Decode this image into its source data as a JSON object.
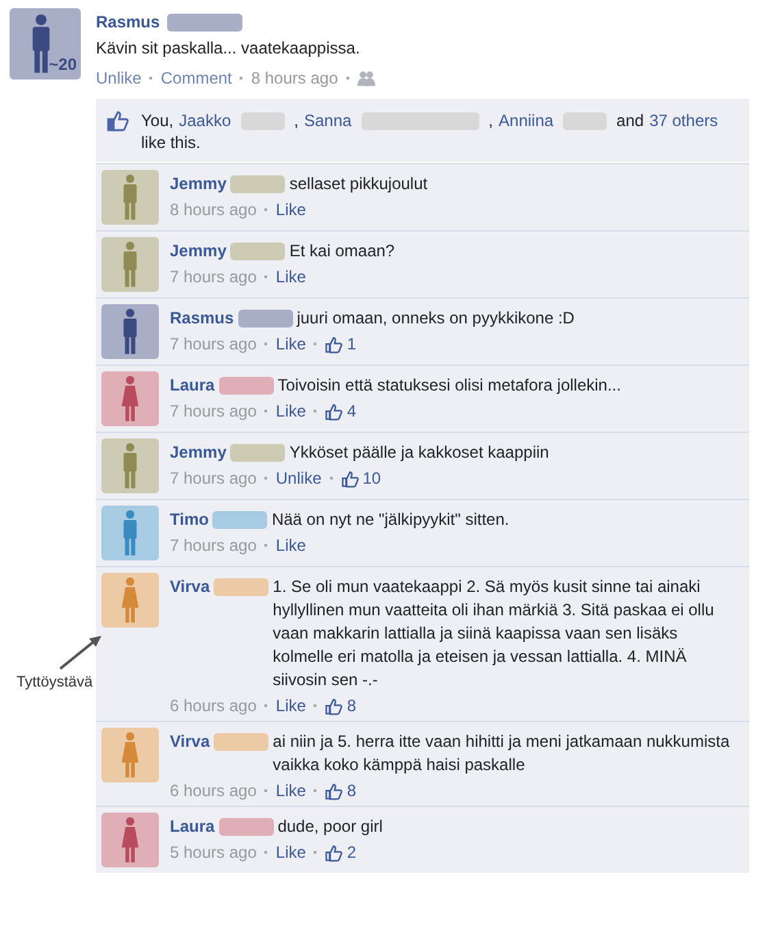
{
  "post": {
    "author": "Rasmus",
    "color": "#3b4a80",
    "kind": "male",
    "avatar_badge": "~20",
    "text": "Kävin sit paskalla... vaatekaappissa.",
    "actions": [
      {
        "kind": "link",
        "text": "Unlike"
      },
      {
        "kind": "link",
        "text": "Comment"
      },
      {
        "kind": "time",
        "text": "8 hours ago"
      },
      {
        "kind": "audience"
      }
    ]
  },
  "likes": {
    "parts": [
      {
        "kind": "text",
        "text": "You,"
      },
      {
        "kind": "link",
        "text": "Jaakko"
      },
      {
        "kind": "redacted"
      },
      {
        "kind": "text",
        "text": ","
      },
      {
        "kind": "link",
        "text": "Sanna"
      },
      {
        "kind": "redacted-long"
      },
      {
        "kind": "text",
        "text": ","
      },
      {
        "kind": "link",
        "text": "Anniina"
      },
      {
        "kind": "redacted"
      },
      {
        "kind": "text",
        "text": "and"
      },
      {
        "kind": "link",
        "text": "37 others"
      },
      {
        "kind": "text",
        "text": "like this."
      }
    ]
  },
  "comments": [
    {
      "author": "Jemmy",
      "kind": "male",
      "color": "#8f8b55",
      "text": "sellaset pikkujoulut",
      "time": "8 hours ago",
      "like_label": "Like"
    },
    {
      "author": "Jemmy",
      "kind": "male",
      "color": "#8f8b55",
      "text": "Et kai omaan?",
      "time": "7 hours ago",
      "like_label": "Like"
    },
    {
      "author": "Rasmus",
      "kind": "male",
      "color": "#3b4a80",
      "text": "juuri omaan, onneks on pyykkikone :D",
      "time": "7 hours ago",
      "like_label": "Like",
      "likes": "1"
    },
    {
      "author": "Laura",
      "kind": "female",
      "color": "#b84b5c",
      "text": "Toivoisin että statuksesi olisi metafora jollekin...",
      "time": "7 hours ago",
      "like_label": "Like",
      "likes": "4"
    },
    {
      "author": "Jemmy",
      "kind": "male",
      "color": "#8f8b55",
      "text": "Ykköset päälle ja kakkoset kaappiin",
      "time": "7 hours ago",
      "like_label": "Unlike",
      "likes": "10"
    },
    {
      "author": "Timo",
      "kind": "male",
      "color": "#3a8bc0",
      "text": "Nää on nyt ne \"jälkipyykit\" sitten.",
      "time": "7 hours ago",
      "like_label": "Like"
    },
    {
      "author": "Virva",
      "kind": "female",
      "color": "#d58a3a",
      "text": "1. Se oli mun vaatekaappi 2. Sä myös kusit sinne tai ainaki hyllyllinen mun vaatteita oli ihan märkiä 3. Sitä paskaa ei ollu vaan makkarin lattialla ja siinä kaapissa vaan sen lisäks kolmelle eri matolla ja eteisen ja vessan lattialla. 4. MINÄ siivosin sen -.-",
      "time": "6 hours ago",
      "like_label": "Like",
      "likes": "8",
      "annotation": "Tyttöystävä"
    },
    {
      "author": "Virva",
      "kind": "female",
      "color": "#d58a3a",
      "text": "ai niin ja 5. herra itte vaan hihitti ja meni jatkamaan nukkumista vaikka koko kämppä haisi paskalle",
      "time": "6 hours ago",
      "like_label": "Like",
      "likes": "8"
    },
    {
      "author": "Laura",
      "kind": "female",
      "color": "#b84b5c",
      "text": "dude, poor girl",
      "time": "5 hours ago",
      "like_label": "Like",
      "likes": "2"
    }
  ]
}
